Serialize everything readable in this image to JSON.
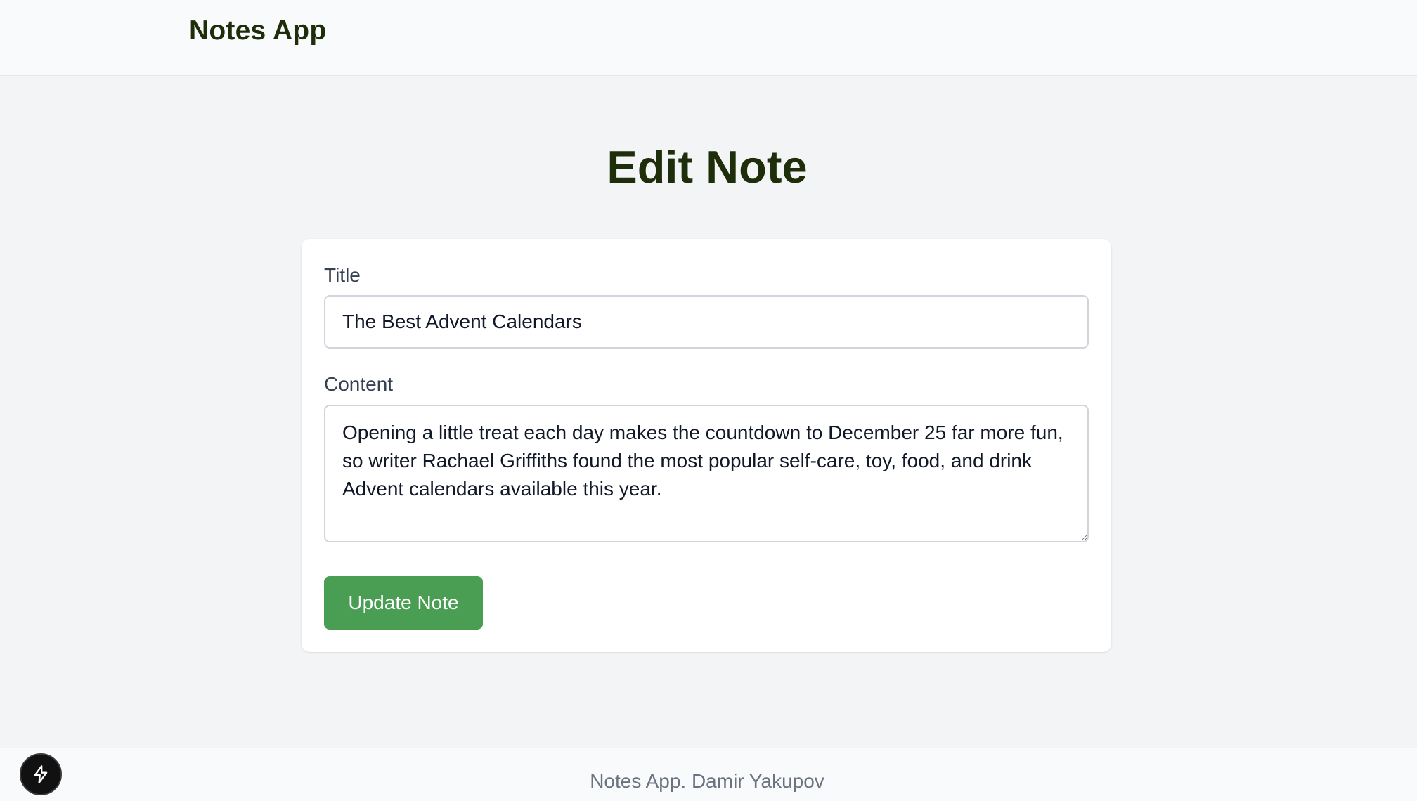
{
  "header": {
    "brand": "Notes App"
  },
  "main": {
    "heading": "Edit Note",
    "form": {
      "title_label": "Title",
      "title_value": "The Best Advent Calendars",
      "content_label": "Content",
      "content_value": "Opening a little treat each day makes the countdown to December 25 far more fun, so writer Rachael Griffiths found the most popular self-care, toy, food, and drink Advent calendars available this year.",
      "submit_label": "Update Note"
    }
  },
  "footer": {
    "text": "Notes App. Damir Yakupov"
  },
  "dev_button": {
    "icon": "lightning-bolt-icon"
  },
  "colors": {
    "accent": "#4a9e53",
    "heading": "#1f2e0a",
    "background": "#f3f4f6"
  }
}
